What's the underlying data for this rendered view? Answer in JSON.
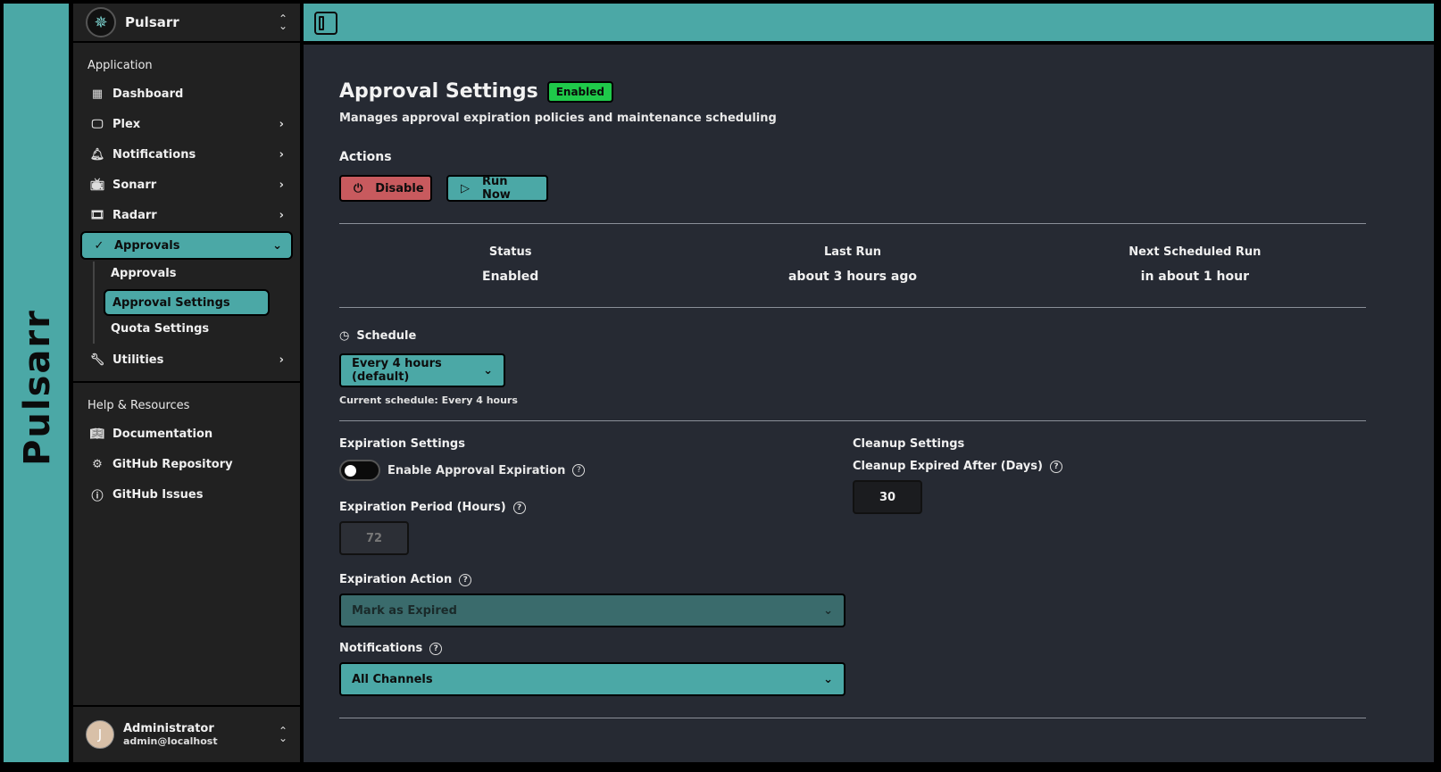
{
  "brand": {
    "vertical_text": "Pulsarr"
  },
  "sidebar": {
    "app_name": "Pulsarr",
    "group_application": "Application",
    "items": [
      {
        "label": "Dashboard",
        "icon": "dashboard-icon"
      },
      {
        "label": "Plex",
        "icon": "monitor-icon"
      },
      {
        "label": "Notifications",
        "icon": "bell-icon"
      },
      {
        "label": "Sonarr",
        "icon": "tv-icon"
      },
      {
        "label": "Radarr",
        "icon": "film-icon"
      },
      {
        "label": "Approvals",
        "icon": "check-circle-icon"
      },
      {
        "label": "Utilities",
        "icon": "wrench-icon"
      }
    ],
    "approvals_sub": [
      "Approvals",
      "Approval Settings",
      "Quota Settings"
    ],
    "group_help": "Help & Resources",
    "help_items": [
      {
        "label": "Documentation",
        "icon": "book-icon"
      },
      {
        "label": "GitHub Repository",
        "icon": "bot-icon"
      },
      {
        "label": "GitHub Issues",
        "icon": "alert-circle-icon"
      }
    ],
    "user": {
      "initial": "J",
      "name": "Administrator",
      "email": "admin@localhost"
    }
  },
  "page": {
    "title": "Approval Settings",
    "status_badge": "Enabled",
    "subtitle": "Manages approval expiration policies and maintenance scheduling",
    "actions_heading": "Actions",
    "disable_label": "Disable",
    "run_now_label": "Run Now",
    "stats": [
      {
        "label": "Status",
        "value": "Enabled"
      },
      {
        "label": "Last Run",
        "value": "about 3 hours ago"
      },
      {
        "label": "Next Scheduled Run",
        "value": "in about 1 hour"
      }
    ],
    "schedule_label": "Schedule",
    "schedule_value": "Every 4 hours (default)",
    "schedule_hint": "Current schedule: Every 4 hours",
    "expiration": {
      "heading": "Expiration Settings",
      "toggle_label": "Enable Approval Expiration",
      "toggle_on": false,
      "period_label": "Expiration Period (Hours)",
      "period_value": "72",
      "action_label": "Expiration Action",
      "action_value": "Mark as Expired",
      "notifications_label": "Notifications",
      "notifications_value": "All Channels"
    },
    "cleanup": {
      "heading": "Cleanup Settings",
      "days_label": "Cleanup Expired After (Days)",
      "days_value": "30"
    }
  },
  "colors": {
    "accent": "#4ba8a6",
    "danger": "#c85a5e",
    "success": "#1fc94a",
    "bg": "#262a33",
    "sidebar": "#212121"
  }
}
